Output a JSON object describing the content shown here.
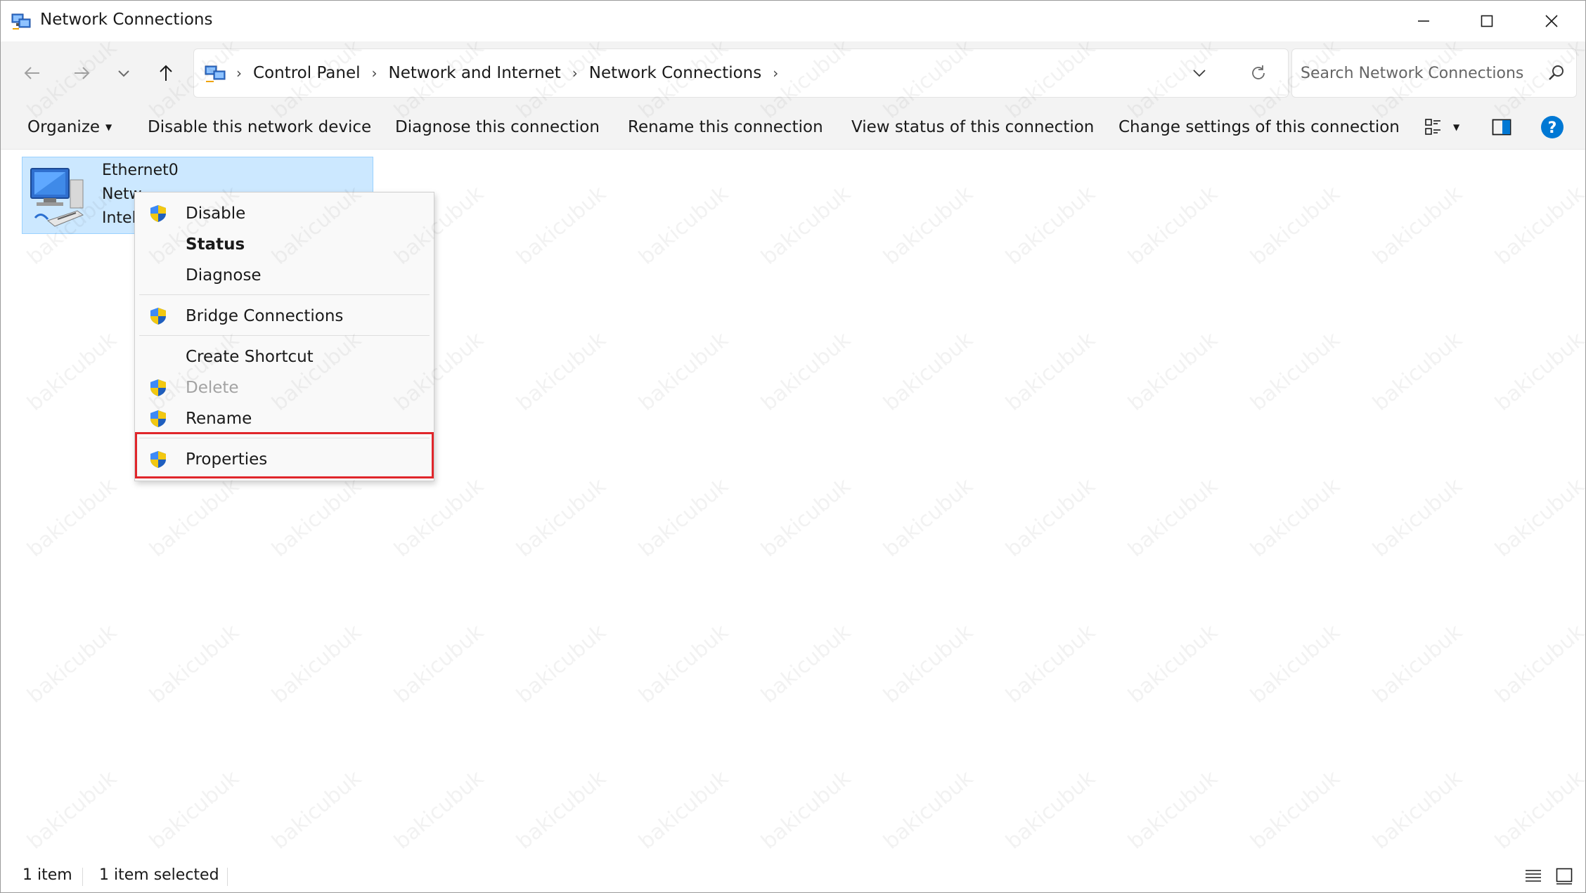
{
  "window": {
    "title": "Network Connections",
    "minimize_icon": "minimize-icon",
    "maximize_icon": "maximize-icon",
    "close_icon": "close-icon"
  },
  "nav": {
    "back_icon": "arrow-left-icon",
    "forward_icon": "arrow-right-icon",
    "recent_icon": "chevron-down-icon",
    "up_icon": "arrow-up-icon"
  },
  "address": {
    "crumbs": [
      "Control Panel",
      "Network and Internet",
      "Network Connections"
    ],
    "dropdown_icon": "chevron-down-icon",
    "refresh_icon": "refresh-icon"
  },
  "search": {
    "placeholder": "Search Network Connections",
    "icon": "search-icon"
  },
  "commands": {
    "organize": "Organize",
    "disable": "Disable this network device",
    "diagnose": "Diagnose this connection",
    "rename": "Rename this connection",
    "view_status": "View status of this connection",
    "change_settings": "Change settings of this connection"
  },
  "connection": {
    "name": "Ethernet0",
    "line2": "Netw",
    "line3": "Intel"
  },
  "context_menu": {
    "items": [
      {
        "label": "Disable",
        "shield": true
      },
      {
        "label": "Status",
        "bold": true
      },
      {
        "label": "Diagnose"
      },
      {
        "label": "Bridge Connections",
        "shield": true
      },
      {
        "label": "Create Shortcut"
      },
      {
        "label": "Delete",
        "shield": true,
        "disabled": true
      },
      {
        "label": "Rename",
        "shield": true
      },
      {
        "label": "Properties",
        "shield": true,
        "highlighted": true
      }
    ]
  },
  "status": {
    "count": "1 item",
    "selected": "1 item selected"
  },
  "watermark": "bakicubuk",
  "colors": {
    "selection": "#cce8ff",
    "highlight_border": "#e0262b",
    "help_blue": "#0078d4"
  }
}
